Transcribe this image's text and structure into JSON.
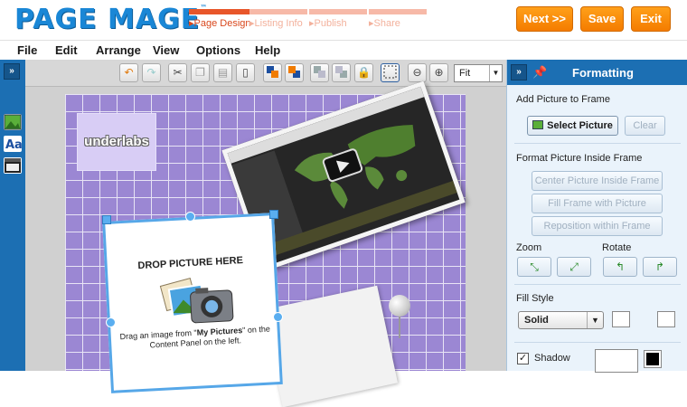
{
  "app": {
    "logo": "PAGE MAGE",
    "logo_mark": "™",
    "steps": [
      {
        "label": "Page Design",
        "active": true
      },
      {
        "label": "Listing Info",
        "active": false
      },
      {
        "label": "Publish",
        "active": false
      },
      {
        "label": "Share",
        "active": false
      }
    ],
    "buttons": {
      "next": "Next >>",
      "save": "Save",
      "exit": "Exit"
    }
  },
  "menu": [
    "File",
    "Edit",
    "Arrange",
    "View",
    "Options",
    "Help"
  ],
  "toolbar": {
    "zoom_value": "Fit",
    "icons": [
      "undo-icon",
      "redo-icon",
      "cut-icon",
      "copy-icon",
      "paste-icon",
      "delete-icon",
      "bring-forward-icon",
      "send-backward-icon",
      "bring-to-front-icon",
      "send-to-back-icon",
      "lock-icon",
      "select-icon",
      "zoom-out-icon",
      "zoom-in-icon"
    ]
  },
  "left_rail": {
    "expand_glyph": "»",
    "icons": [
      "picture-icon",
      "text-icon",
      "video-icon"
    ]
  },
  "canvas": {
    "logo_frame_text": "underlabs",
    "drop_frame": {
      "title": "DROP PICTURE HERE",
      "hint_prefix": "Drag an image from \"",
      "hint_strong": "My Pictures",
      "hint_suffix": "\" on the Content Panel on the left."
    }
  },
  "panel": {
    "expand_glyph": "»",
    "title": "Formatting",
    "add_picture": {
      "heading": "Add Picture to Frame",
      "select": "Select Picture",
      "clear": "Clear"
    },
    "format_inside": {
      "heading": "Format Picture Inside Frame",
      "center": "Center Picture Inside Frame",
      "fill": "Fill Frame with Picture",
      "reposition": "Reposition within Frame"
    },
    "zoom_label": "Zoom",
    "rotate_label": "Rotate",
    "fill_style": {
      "heading": "Fill Style",
      "value": "Solid"
    },
    "shadow": {
      "label": "Shadow",
      "checked": true,
      "check_glyph": "✓"
    }
  },
  "colors": {
    "brand_blue": "#1a87d6",
    "orange": "#f47c00",
    "step_active": "#e8562a",
    "page_purple": "#9b87d3",
    "panel_bg": "#eaf3fb"
  }
}
